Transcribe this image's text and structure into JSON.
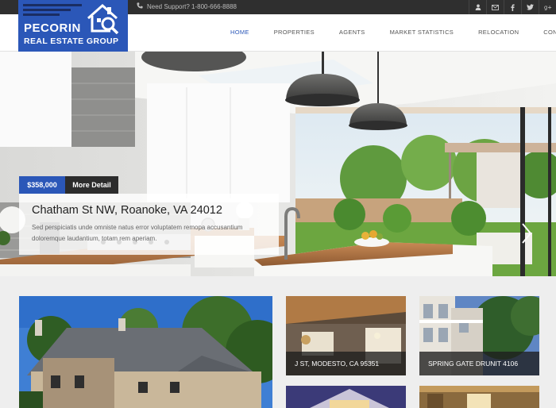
{
  "topbar": {
    "support_text": "Need Support? 1-800-666-8888",
    "social_icons": [
      "user-icon",
      "mail-icon",
      "facebook-icon",
      "twitter-icon",
      "google-plus-icon"
    ]
  },
  "logo": {
    "line1": "PECORIN",
    "line2": "REAL ESTATE GROUP"
  },
  "nav": {
    "items": [
      {
        "label": "HOME"
      },
      {
        "label": "PROPERTIES"
      },
      {
        "label": "AGENTS"
      },
      {
        "label": "MARKET STATISTICS"
      },
      {
        "label": "RELOCATION"
      },
      {
        "label": "CONTACT US"
      }
    ]
  },
  "hero": {
    "price": "$358,000",
    "more_label": "More Detail",
    "title": "Chatham St NW, Roanoke, VA 24012",
    "description": "Sed perspiciatis unde omniste natus error voluptatem remopa accusantium doloremque laudantium, totam rem aperiam."
  },
  "listings": [
    {
      "label": "J ST, MODESTO, CA 95351"
    },
    {
      "label": "SPRING GATE DRUNIT 4106"
    }
  ],
  "colors": {
    "brand": "#2b57b8",
    "topbar": "#2f2f2f",
    "dark_tag": "#2c2c2c"
  }
}
